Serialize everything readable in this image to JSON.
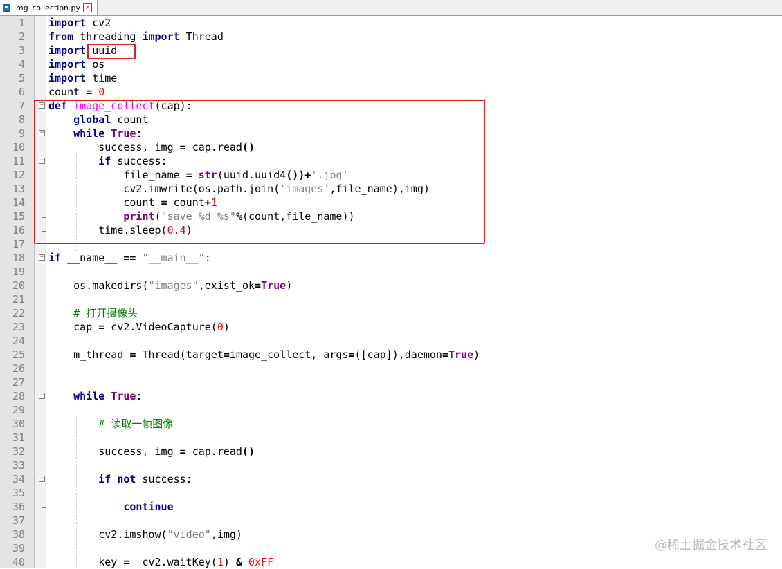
{
  "tab": {
    "filename": "img_collection.py",
    "close": "×"
  },
  "watermark": "@稀土掘金技术社区",
  "lines": [
    {
      "n": "1",
      "t": [
        {
          "c": "kw",
          "v": "import"
        },
        {
          "v": " cv2"
        }
      ]
    },
    {
      "n": "2",
      "t": [
        {
          "c": "kw",
          "v": "from"
        },
        {
          "v": " threading "
        },
        {
          "c": "kw",
          "v": "import"
        },
        {
          "v": " Thread"
        }
      ]
    },
    {
      "n": "3",
      "t": [
        {
          "c": "kw",
          "v": "import"
        },
        {
          "v": " uuid"
        }
      ]
    },
    {
      "n": "4",
      "t": [
        {
          "c": "kw",
          "v": "import"
        },
        {
          "v": " os"
        }
      ]
    },
    {
      "n": "5",
      "t": [
        {
          "c": "kw",
          "v": "import"
        },
        {
          "v": " time"
        }
      ]
    },
    {
      "n": "6",
      "t": [
        {
          "v": "count "
        },
        {
          "c": "op",
          "v": "="
        },
        {
          "v": " "
        },
        {
          "c": "num",
          "v": "0"
        }
      ]
    },
    {
      "n": "7",
      "t": [
        {
          "c": "kw",
          "v": "def"
        },
        {
          "v": " "
        },
        {
          "c": "fn",
          "v": "image_collect"
        },
        {
          "v": "(cap):"
        }
      ]
    },
    {
      "n": "8",
      "t": [
        {
          "v": "    "
        },
        {
          "c": "kw",
          "v": "global"
        },
        {
          "v": " count"
        }
      ]
    },
    {
      "n": "9",
      "t": [
        {
          "v": "    "
        },
        {
          "c": "kw",
          "v": "while"
        },
        {
          "v": " "
        },
        {
          "c": "kw2",
          "v": "True"
        },
        {
          "v": ":"
        }
      ]
    },
    {
      "n": "10",
      "t": [
        {
          "v": "        success, img "
        },
        {
          "c": "op",
          "v": "="
        },
        {
          "v": " cap.read"
        },
        {
          "c": "op",
          "v": "()"
        }
      ]
    },
    {
      "n": "11",
      "t": [
        {
          "v": "        "
        },
        {
          "c": "kw",
          "v": "if"
        },
        {
          "v": " success:"
        }
      ]
    },
    {
      "n": "12",
      "t": [
        {
          "v": "            file_name "
        },
        {
          "c": "op",
          "v": "="
        },
        {
          "v": " "
        },
        {
          "c": "kw2",
          "v": "str"
        },
        {
          "v": "(uuid.uuid4"
        },
        {
          "c": "op",
          "v": "())+"
        },
        {
          "c": "str",
          "v": "'.jpg'"
        }
      ]
    },
    {
      "n": "13",
      "t": [
        {
          "v": "            cv2.imwrite(os.path.join("
        },
        {
          "c": "str",
          "v": "'images'"
        },
        {
          "v": ",file_name),img)"
        }
      ]
    },
    {
      "n": "14",
      "t": [
        {
          "v": "            count "
        },
        {
          "c": "op",
          "v": "="
        },
        {
          "v": " count"
        },
        {
          "c": "op",
          "v": "+"
        },
        {
          "c": "num",
          "v": "1"
        }
      ]
    },
    {
      "n": "15",
      "t": [
        {
          "v": "            "
        },
        {
          "c": "kw2",
          "v": "print"
        },
        {
          "v": "("
        },
        {
          "c": "str",
          "v": "\"save %d %s\""
        },
        {
          "v": "%(count,file_name))"
        }
      ]
    },
    {
      "n": "16",
      "t": [
        {
          "v": "        time.sleep("
        },
        {
          "c": "num",
          "v": "0.4"
        },
        {
          "v": ")"
        }
      ]
    },
    {
      "n": "17",
      "t": []
    },
    {
      "n": "18",
      "t": [
        {
          "c": "kw",
          "v": "if"
        },
        {
          "v": " __name__ "
        },
        {
          "c": "op",
          "v": "=="
        },
        {
          "v": " "
        },
        {
          "c": "str",
          "v": "\"__main__\""
        },
        {
          "v": ":"
        }
      ]
    },
    {
      "n": "19",
      "t": []
    },
    {
      "n": "20",
      "t": [
        {
          "v": "    os.makedirs("
        },
        {
          "c": "str",
          "v": "\"images\""
        },
        {
          "v": ",exist_ok"
        },
        {
          "c": "op",
          "v": "="
        },
        {
          "c": "kw2",
          "v": "True"
        },
        {
          "v": ")"
        }
      ]
    },
    {
      "n": "21",
      "t": []
    },
    {
      "n": "22",
      "t": [
        {
          "v": "    "
        },
        {
          "c": "cm",
          "v": "# 打开摄像头"
        }
      ]
    },
    {
      "n": "23",
      "t": [
        {
          "v": "    cap "
        },
        {
          "c": "op",
          "v": "="
        },
        {
          "v": " cv2.VideoCapture("
        },
        {
          "c": "num",
          "v": "0"
        },
        {
          "v": ")"
        }
      ]
    },
    {
      "n": "24",
      "t": []
    },
    {
      "n": "25",
      "t": [
        {
          "v": "    m_thread "
        },
        {
          "c": "op",
          "v": "="
        },
        {
          "v": " Thread(target"
        },
        {
          "c": "op",
          "v": "="
        },
        {
          "v": "image_collect, args"
        },
        {
          "c": "op",
          "v": "="
        },
        {
          "v": "([cap]),daemon"
        },
        {
          "c": "op",
          "v": "="
        },
        {
          "c": "kw2",
          "v": "True"
        },
        {
          "v": ")"
        }
      ]
    },
    {
      "n": "26",
      "t": []
    },
    {
      "n": "27",
      "t": []
    },
    {
      "n": "28",
      "t": [
        {
          "v": "    "
        },
        {
          "c": "kw",
          "v": "while"
        },
        {
          "v": " "
        },
        {
          "c": "kw2",
          "v": "True"
        },
        {
          "v": ":"
        }
      ]
    },
    {
      "n": "29",
      "t": []
    },
    {
      "n": "30",
      "t": [
        {
          "v": "        "
        },
        {
          "c": "cm",
          "v": "# 读取一帧图像"
        }
      ]
    },
    {
      "n": "31",
      "t": []
    },
    {
      "n": "32",
      "t": [
        {
          "v": "        success, img "
        },
        {
          "c": "op",
          "v": "="
        },
        {
          "v": " cap.read"
        },
        {
          "c": "op",
          "v": "()"
        }
      ]
    },
    {
      "n": "33",
      "t": []
    },
    {
      "n": "34",
      "t": [
        {
          "v": "        "
        },
        {
          "c": "kw",
          "v": "if"
        },
        {
          "v": " "
        },
        {
          "c": "kw",
          "v": "not"
        },
        {
          "v": " success:"
        }
      ]
    },
    {
      "n": "35",
      "t": []
    },
    {
      "n": "36",
      "t": [
        {
          "v": "            "
        },
        {
          "c": "kw",
          "v": "continue"
        }
      ]
    },
    {
      "n": "37",
      "t": []
    },
    {
      "n": "38",
      "t": [
        {
          "v": "        cv2.imshow("
        },
        {
          "c": "str",
          "v": "\"video\""
        },
        {
          "v": ",img)"
        }
      ]
    },
    {
      "n": "39",
      "t": []
    },
    {
      "n": "40",
      "t": [
        {
          "v": "        key "
        },
        {
          "c": "op",
          "v": "="
        },
        {
          "v": "  cv2.waitKey("
        },
        {
          "c": "num",
          "v": "1"
        },
        {
          "v": ") "
        },
        {
          "c": "op",
          "v": "&"
        },
        {
          "v": " "
        },
        {
          "c": "num",
          "v": "0xFF"
        }
      ]
    }
  ]
}
